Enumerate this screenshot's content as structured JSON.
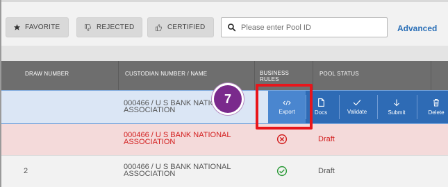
{
  "filters": {
    "favorite": {
      "label": "FAVORITE",
      "icon": "star-icon"
    },
    "rejected": {
      "label": "REJECTED",
      "icon": "thumbs-down-icon"
    },
    "certified": {
      "label": "CERTIFIED",
      "icon": "thumbs-up-icon"
    }
  },
  "search": {
    "placeholder": "Please enter Pool ID",
    "value": ""
  },
  "advanced_label": "Advanced",
  "table": {
    "columns": [
      "DRAW NUMBER",
      "CUSTODIAN NUMBER / NAME",
      "BUSINESS RULES",
      "POOL STATUS"
    ],
    "rows": [
      {
        "draw_number": "",
        "custodian": "000466 / U S BANK NATIONAL ASSOCIATION",
        "rules": "",
        "status": ""
      },
      {
        "draw_number": "",
        "custodian": "000466 / U S BANK NATIONAL ASSOCIATION",
        "rules": "failed",
        "status": "Draft"
      },
      {
        "draw_number": "2",
        "custodian": "000466 / U S BANK NATIONAL ASSOCIATION",
        "rules": "passed",
        "status": "Draft"
      }
    ]
  },
  "row_actions": [
    {
      "label": "Export",
      "icon": "code-icon"
    },
    {
      "label": "Docs",
      "icon": "document-icon"
    },
    {
      "label": "Validate",
      "icon": "check-icon"
    },
    {
      "label": "Submit",
      "icon": "arrow-down-icon"
    },
    {
      "label": "Delete",
      "icon": "trash-icon"
    }
  ],
  "step_badge": "7",
  "colors": {
    "accent": "#2a6fb7",
    "action_bar": "#2e6bb5",
    "error": "#d32020",
    "success": "#2e9b3a",
    "badge": "#7a2a8c",
    "highlight": "#e8151b"
  }
}
